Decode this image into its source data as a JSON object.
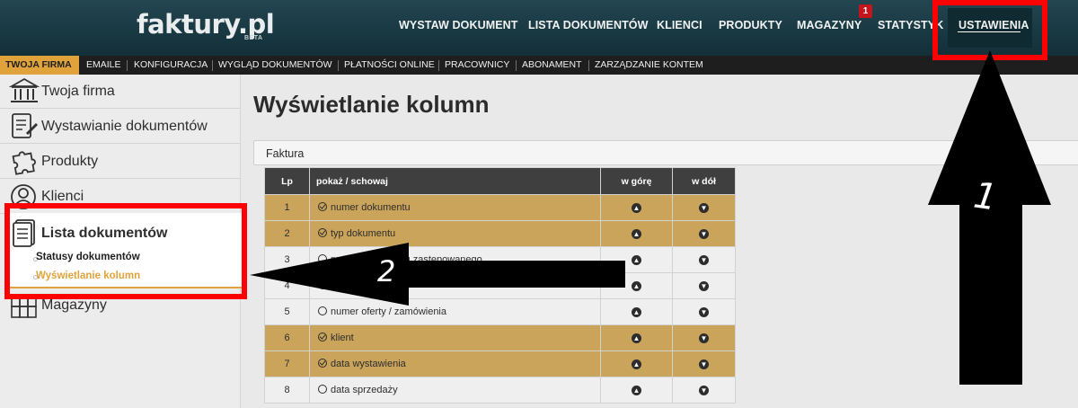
{
  "header": {
    "logo": "faktury.pl",
    "logo_badge": "BETA",
    "nav": [
      {
        "label": "WYSTAW DOKUMENT"
      },
      {
        "label": "LISTA DOKUMENTÓW"
      },
      {
        "label": "KLIENCI"
      },
      {
        "label": "PRODUKTY"
      },
      {
        "label": "MAGAZYNY",
        "badge": "1"
      },
      {
        "label": "STATYSTYK"
      },
      {
        "label": "USTAWIENIA",
        "active": true
      }
    ]
  },
  "submenu": [
    {
      "label": "TWOJA FIRMA",
      "active": true
    },
    {
      "label": "EMAILE"
    },
    {
      "label": "KONFIGURACJA"
    },
    {
      "label": "WYGLĄD DOKUMENTÓW"
    },
    {
      "label": "PŁATNOŚCI ONLINE"
    },
    {
      "label": "PRACOWNICY"
    },
    {
      "label": "ABONAMENT"
    },
    {
      "label": "ZARZĄDZANIE KONTEM"
    }
  ],
  "sidebar": {
    "items": [
      {
        "label": "Twoja firma",
        "icon": "bank-icon"
      },
      {
        "label": "Wystawianie dokumentów",
        "icon": "document-pen-icon"
      },
      {
        "label": "Produkty",
        "icon": "puzzle-icon"
      },
      {
        "label": "Klienci",
        "icon": "person-icon"
      },
      {
        "label": "Lista dokumentów",
        "icon": "document-list-icon",
        "expanded": true
      },
      {
        "label": "Magazyny",
        "icon": "warehouse-icon"
      }
    ],
    "subitems": [
      {
        "label": "Statusy dokumentów",
        "active": false
      },
      {
        "label": "Wyświetlanie kolumn",
        "active": true
      }
    ]
  },
  "main": {
    "title": "Wyświetlanie kolumn",
    "document_type": "Faktura",
    "table": {
      "headers": [
        "Lp",
        "pokaż / schowaj",
        "w górę",
        "w dół"
      ],
      "rows": [
        {
          "lp": "1",
          "name": "numer dokumentu",
          "shown": true
        },
        {
          "lp": "2",
          "name": "typ dokumentu",
          "shown": true
        },
        {
          "lp": "3",
          "name": "numer dokumentu zastępowanego",
          "shown": false
        },
        {
          "lp": "4",
          "name": "",
          "shown": false
        },
        {
          "lp": "5",
          "name": "numer oferty / zamówienia",
          "shown": false
        },
        {
          "lp": "6",
          "name": "klient",
          "shown": true
        },
        {
          "lp": "7",
          "name": "data wystawienia",
          "shown": true
        },
        {
          "lp": "8",
          "name": "data sprzedaży",
          "shown": false
        }
      ]
    }
  },
  "annotations": {
    "step1": "1",
    "step2": "2",
    "highlight_color": "#ff0000",
    "arrow_color": "#000000"
  },
  "colors": {
    "header_bg": "#183842",
    "accent": "#e0a33c",
    "row_on": "#c9a45a",
    "row_off": "#efefef",
    "badge": "#c4151c"
  }
}
